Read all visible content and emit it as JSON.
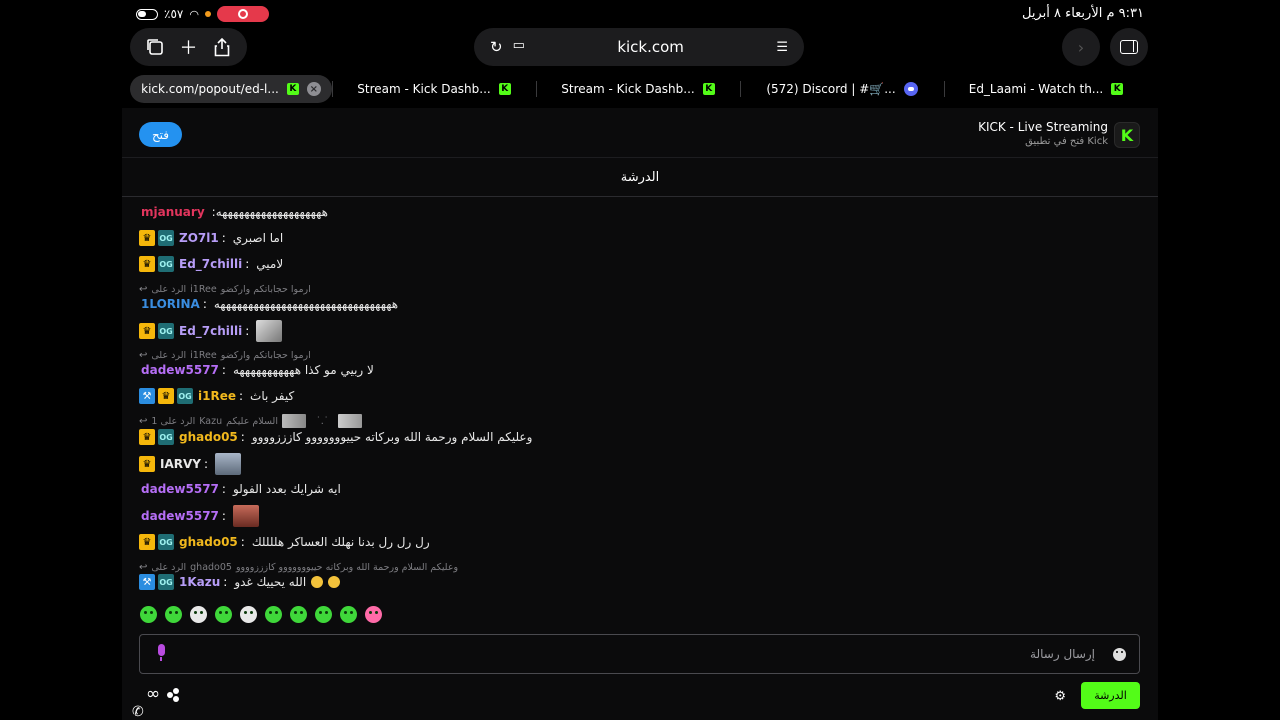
{
  "status_bar": {
    "time_date": "٩:٣١ م  الأربعاء ٨ أبريل",
    "battery": "٪٥٧"
  },
  "browser": {
    "url": "kick.com",
    "tabs": [
      {
        "label": "kick.com/popout/ed-l..."
      },
      {
        "label": "Stream - Kick Dashb..."
      },
      {
        "label": "Stream - Kick Dashb..."
      },
      {
        "label": "(572) Discord | #🛒..."
      },
      {
        "label": "Ed_Laami - Watch th..."
      }
    ]
  },
  "app_banner": {
    "open_label": "فتح",
    "title": "KICK - Live Streaming",
    "subtitle": "فتح في تطبيق Kick"
  },
  "chat": {
    "header": "الدرشة",
    "top_user": {
      "user": "mjanuary",
      "text": ":هههههههههههههههههههه",
      "color": "#e2355d"
    },
    "messages": [
      {
        "user": "ZO7l1",
        "text": "اما اصبري",
        "color": "#b79df7"
      },
      {
        "user": "Ed_7chilli",
        "text": "لاميي",
        "color": "#b79df7"
      },
      {
        "reply_to": "i1Ree",
        "reply_text": "ارموا حجاباتكم واركضو",
        "reply_prefix": "الرد على"
      },
      {
        "user": "1LORINA",
        "text": "ههههههههههههههههههههههههههههههههه",
        "color": "#3a8de0"
      },
      {
        "user": "Ed_7chilli",
        "text": "",
        "color": "#b79df7"
      },
      {
        "reply_to": "i1Ree",
        "reply_text": "ارموا حجاباتكم واركضو",
        "reply_prefix": "الرد على"
      },
      {
        "user": "dadew5577",
        "text": "لا ربيي مو كذا هههههههههههه",
        "color": "#b56ef5"
      },
      {
        "user": "i1Ree",
        "text": "كيفر باث",
        "color": "#f1b81d"
      },
      {
        "reply_to": "Kazu",
        "reply_text": "السلام عليكم",
        "reply_prefix": "الرد على 1"
      },
      {
        "user": "ghado05",
        "text": "وعليكم السلام ورحمة الله وبركاته حييووووووو كازززوووو",
        "color": "#f1b81d"
      },
      {
        "user": "IARVY",
        "text": "",
        "color": "#e8e8e8"
      },
      {
        "user": "dadew5577",
        "text": "ايه شرايك بعدد الفولو",
        "color": "#b56ef5"
      },
      {
        "user": "dadew5577",
        "text": "",
        "color": "#b56ef5"
      },
      {
        "user": "ghado05",
        "text": "رل رل رل بدنا نهلك العساكر هللللك",
        "color": "#f1b81d"
      },
      {
        "reply_to": "ghado05",
        "reply_text": "وعليكم السلام ورحمة الله وبركاته حييووووووو كازززوووو",
        "reply_prefix": "الرد على"
      },
      {
        "user": "1Kazu",
        "text": "الله يحييك غدو",
        "color": "#b79df7"
      }
    ]
  },
  "input": {
    "placeholder": "إرسال رسالة"
  },
  "bottom": {
    "chat_button": "الدرشة"
  },
  "colors": {
    "kick_green": "#53fc18",
    "crown_badge": "#f5b70b",
    "og_badge": "#1f6d74",
    "open_button": "#2492f0"
  }
}
